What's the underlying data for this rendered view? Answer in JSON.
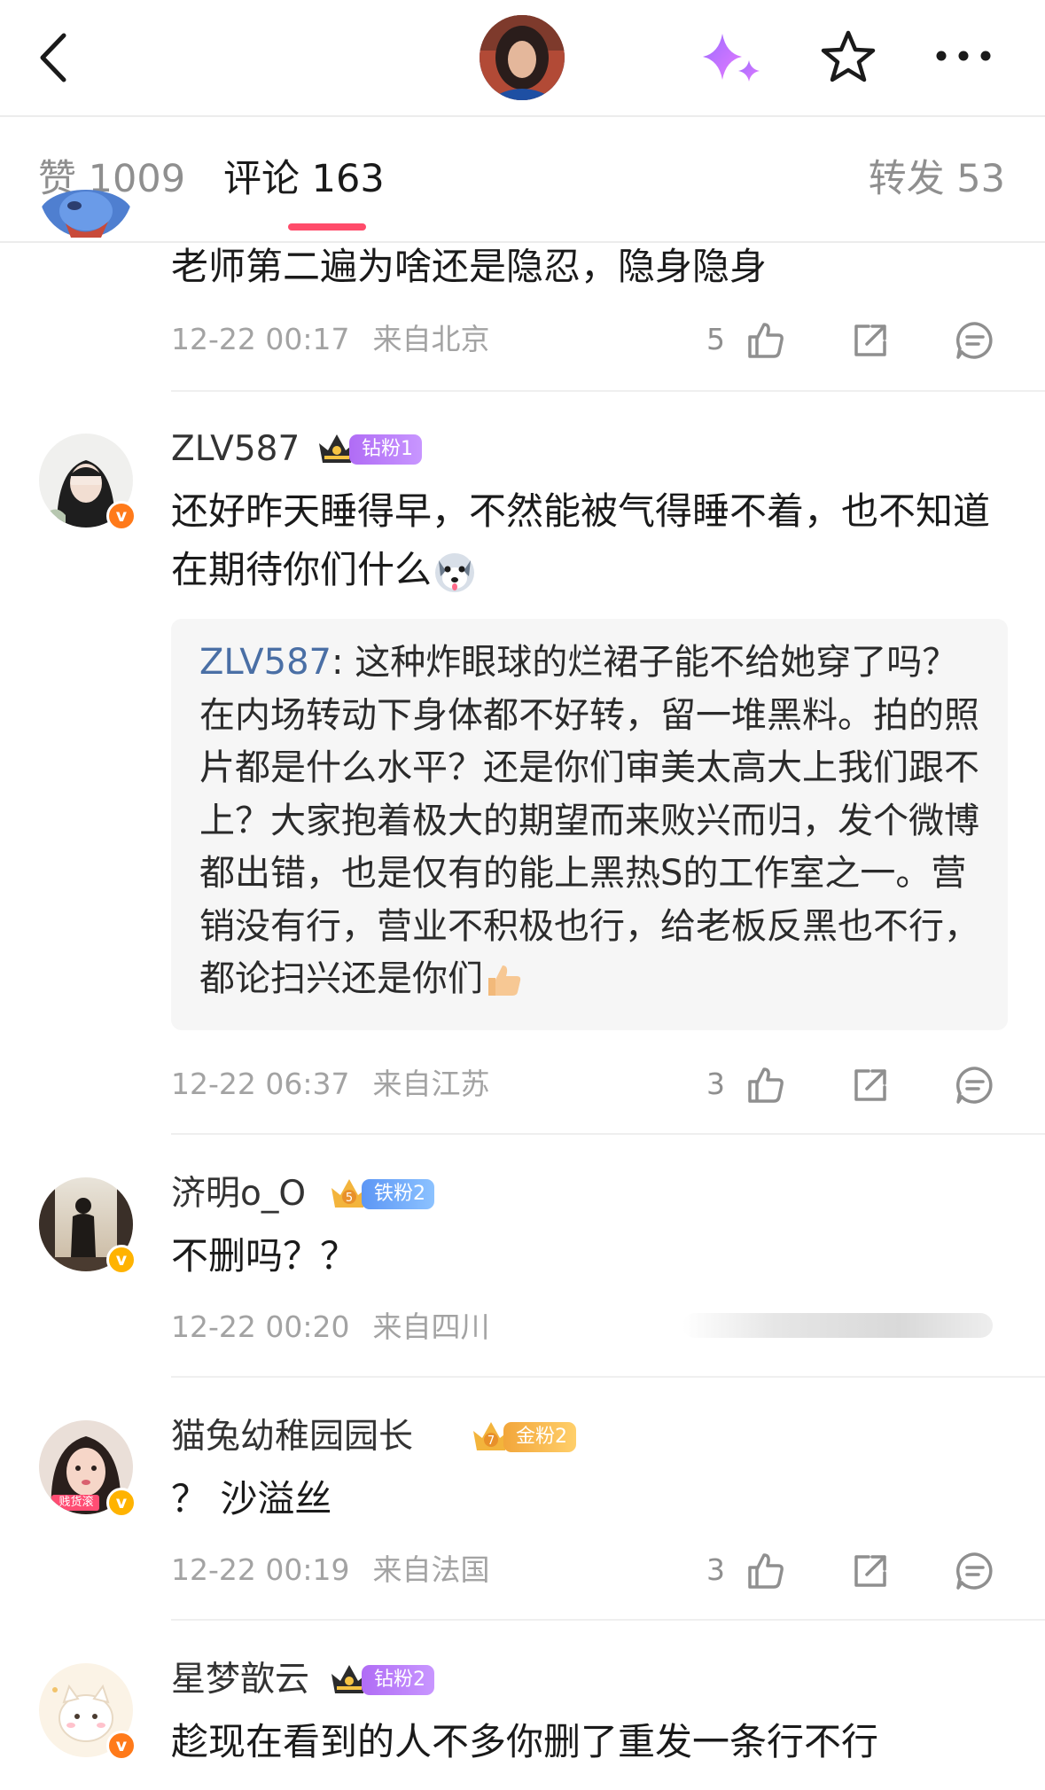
{
  "header": {
    "back_icon": "chevron-left-icon",
    "sparkle_icon": "ai-sparkle-icon",
    "star_icon": "star-outline-icon",
    "more_icon": "more-horizontal-icon",
    "accent_color": "#ff4b6a"
  },
  "tabs": [
    {
      "name": "赞",
      "count": "1009",
      "active": false
    },
    {
      "name": "评论",
      "count": "163",
      "active": true
    },
    {
      "name": "转发",
      "count": "53",
      "active": false
    }
  ],
  "comments": [
    {
      "text": "老师第二遍为啥还是隐忍，隐身隐身",
      "time": "12-22 00:17",
      "location": "来自北京",
      "likes": "5"
    },
    {
      "username": "ZLV587",
      "fan_badge": "钻粉1",
      "text": "还好昨天睡得早，不然能被气得睡不着，也不知道在期待你们什么",
      "quoted_user": "ZLV587",
      "quoted_text": ": 这种炸眼球的烂裙子能不给她穿了吗？在内场转动下身体都不好转，留一堆黑料。拍的照片都是什么水平？还是你们审美太高大上我们跟不上？大家抱着极大的期望而来败兴而归，发个微博都出错，也是仅有的能上黑热S的工作室之一。营销没有行，营业不积极也行，给老板反黑也不行，都论扫兴还是你们",
      "time": "12-22 06:37",
      "location": "来自江苏",
      "likes": "3"
    },
    {
      "username": "济明o_O",
      "fan_badge": "铁粉2",
      "text": "不删吗？？",
      "time": "12-22 00:20",
      "location": "来自四川"
    },
    {
      "username": "猫兔幼稚园园长",
      "fan_badge": "金粉2",
      "avatar_caption": "贱货滚",
      "text": "？ 沙溢丝",
      "time": "12-22 00:19",
      "location": "来自法国",
      "likes": "3"
    },
    {
      "username": "星梦歆云",
      "fan_badge": "钻粉2",
      "text": "趁现在看到的人不多你删了重发一条行不行"
    }
  ],
  "icons": {
    "like": "thumbs-up-icon",
    "share": "share-icon",
    "reply": "reply-bubble-icon"
  }
}
